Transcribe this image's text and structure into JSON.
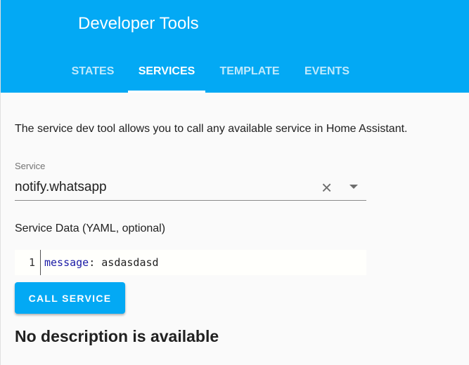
{
  "header": {
    "title": "Developer Tools",
    "tabs": [
      {
        "label": "STATES"
      },
      {
        "label": "SERVICES",
        "active": true
      },
      {
        "label": "TEMPLATE"
      },
      {
        "label": "EVENTS"
      }
    ]
  },
  "main": {
    "description": "The service dev tool allows you to call any available service in Home Assistant.",
    "service_label": "Service",
    "service_value": "notify.whatsapp",
    "clear_icon": "×",
    "yaml_label": "Service Data (YAML, optional)",
    "editor": {
      "line_number": "1",
      "key": "message",
      "colon": ":",
      "value": " asdasdasd"
    },
    "call_button": "CALL SERVICE",
    "no_description": "No description is available"
  },
  "colors": {
    "primary": "#03a9f4"
  }
}
